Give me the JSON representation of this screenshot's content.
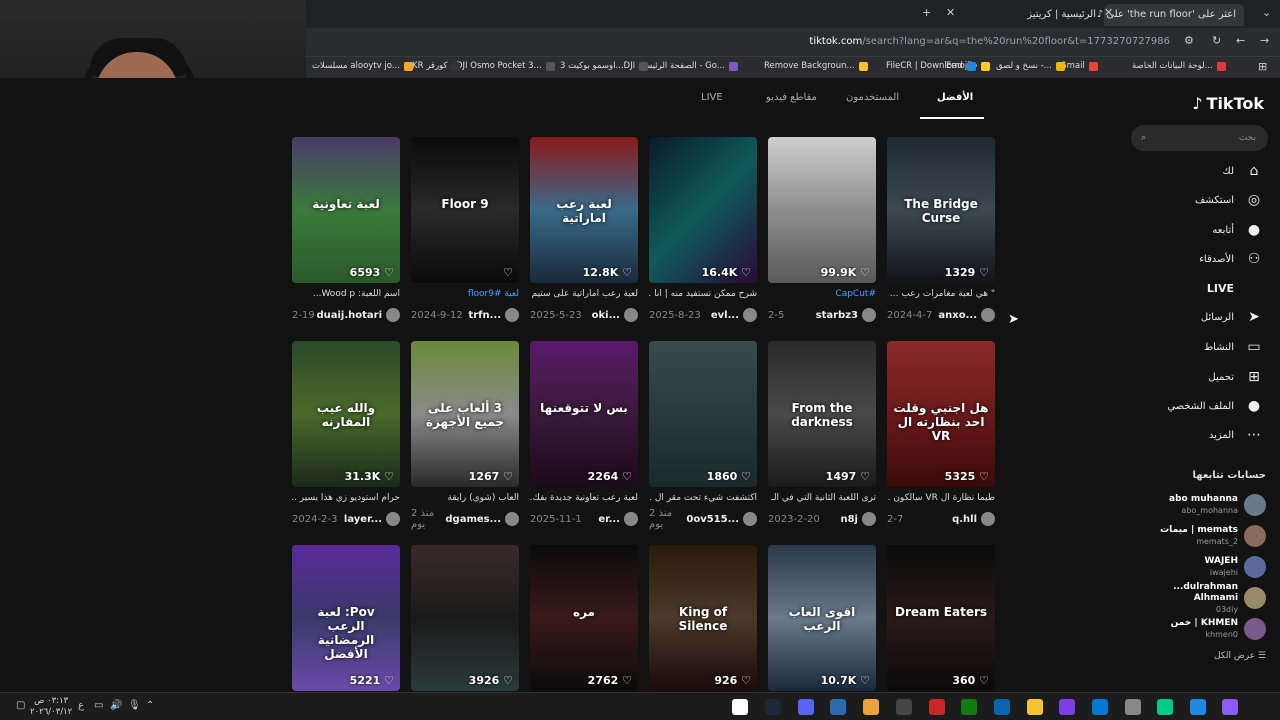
{
  "browser": {
    "tabs": [
      {
        "label": "اعثر على 'the run floor' على"
      },
      {
        "label": "الرئيسية | كريتيز"
      }
    ],
    "new_tab": "+",
    "url_host": "tiktok.com",
    "url_rest": "/search?lang=ar&q=the%20run%20floor&t=1773270727986",
    "bookmarks": [
      {
        "label": "لوحة البيانات الخاصة...",
        "color": "#e53935"
      },
      {
        "label": "Gmail",
        "color": "#ea4335"
      },
      {
        "label": "نسخ و لصق -...",
        "color": "#f4b400"
      },
      {
        "label": "Emojilo",
        "color": "#ffca28"
      },
      {
        "label": "FileCR | Download",
        "color": "#1e88e5"
      },
      {
        "label": "Remove Backgroun...",
        "color": "#fbc02d"
      },
      {
        "label": "الصفحة الرئيسية - Go...",
        "color": "#7e57c2"
      },
      {
        "label": "اوسمو بوكيت 3...DJI",
        "color": "#555"
      },
      {
        "label": "DJI Osmo Pocket 3...",
        "color": "#555"
      },
      {
        "label": "KR كورقر",
        "color": "#333"
      },
      {
        "label": "مسلسلات alooytv jo...",
        "color": "#f9a825"
      }
    ]
  },
  "tiktok": {
    "logo": "TikTok",
    "search_placeholder": "بحث",
    "nav": [
      {
        "label": "لك",
        "icon": "home-icon",
        "glyph": "⌂"
      },
      {
        "label": "استكشف",
        "icon": "compass-icon",
        "glyph": "◎"
      },
      {
        "label": "أتابعه",
        "icon": "avatar-icon",
        "glyph": "●"
      },
      {
        "label": "الأصدقاء",
        "icon": "friends-icon",
        "glyph": "⚇"
      },
      {
        "label": "LIVE",
        "icon": "live-icon",
        "glyph": ""
      },
      {
        "label": "الرسائل",
        "icon": "messages-icon",
        "glyph": "➤"
      },
      {
        "label": "النشاط",
        "icon": "activity-icon",
        "glyph": "▭"
      },
      {
        "label": "تحميل",
        "icon": "upload-icon",
        "glyph": "⊞"
      },
      {
        "label": "الملف الشخصي",
        "icon": "profile-icon",
        "glyph": "●"
      },
      {
        "label": "المزيد",
        "icon": "more-icon",
        "glyph": "⋯"
      }
    ],
    "following_title": "حسابات تتابعها",
    "following": [
      {
        "name": "abo muhanna",
        "handle": "abo_mohanna"
      },
      {
        "name": "ميمات | memats",
        "handle": "memats_2"
      },
      {
        "name": "WAJEH",
        "handle": "iwajehi"
      },
      {
        "name": "...dulrahman Alhmami",
        "handle": "03diy"
      },
      {
        "name": "خمن | KHMEN",
        "handle": "khmen0"
      }
    ],
    "see_all": "عرض الكل",
    "tabs": [
      {
        "label": "الأفضل"
      },
      {
        "label": "المستخدمون"
      },
      {
        "label": "مقاطع فيديو"
      },
      {
        "label": "LIVE"
      }
    ],
    "videos": [
      {
        "likes": "1329",
        "overlay": "The Bridge Curse",
        "desc": "\" هي لعبة مغامرات رعب ...",
        "date": "2024-4-7",
        "user": "anxo...",
        "bg": "linear-gradient(180deg,#1d2a33,#3c4a50,#101418)",
        "tag": false
      },
      {
        "likes": "99.9K",
        "overlay": "",
        "desc": "#CapCut",
        "date": "2-5",
        "user": "starbz3",
        "bg": "linear-gradient(180deg,#cfcfcf,#8e8e8e,#5a5a5a)",
        "tag": true
      },
      {
        "likes": "16.4K",
        "overlay": "",
        "desc": "شرح ممكن تستفيد منه | انا ...",
        "date": "2025-8-23",
        "user": "evl...",
        "bg": "linear-gradient(135deg,#0a1a2a,#0f5a5a,#2a0a3a)",
        "tag": false
      },
      {
        "likes": "12.8K",
        "overlay": "لعبة رعب اماراتية",
        "desc": "لعبة رعب اماراتية على ستيم ...",
        "date": "2025-5-23",
        "user": "oki...",
        "bg": "linear-gradient(180deg,#8a1a1a,#3a6a8a,#1a2a3a)",
        "tag": false
      },
      {
        "likes": "",
        "overlay": "Floor 9",
        "desc": "لعبة #floor9",
        "date": "2024-9-12",
        "user": "trfn...",
        "bg": "linear-gradient(180deg,#0a0a0a,#2a2a2a,#0a0a0a)",
        "tag": true
      },
      {
        "likes": "6593",
        "overlay": "لعبة تعاونية",
        "desc": "اسم اللعبة: Wood p...",
        "date": "2-19",
        "user": "duaij.hotari",
        "bg": "linear-gradient(180deg,#4a3a6a,#3a7a3a,#2a5a2a)",
        "tag": false
      },
      {
        "likes": "5325",
        "overlay": "هل اجنبي وقلت احد بنظارته ال VR",
        "desc": "طيما نظارة ال VR سالكون ...",
        "date": "2-7",
        "user": "q.hll",
        "bg": "linear-gradient(180deg,#8a2a2a,#6a1a1a,#3a0a0a)",
        "tag": false
      },
      {
        "likes": "1497",
        "overlay": "From the darkness",
        "desc": "ترى اللعبة الثانية التي في الـ ...",
        "date": "2023-2-20",
        "user": "n8j",
        "bg": "linear-gradient(180deg,#2a2a2a,#4a4a4a,#1a1a1a)",
        "tag": false
      },
      {
        "likes": "1860",
        "overlay": "",
        "desc": "اكتشفت شيء تحت مقر ال ...",
        "date": "منذ 2 يوم",
        "user": "0ov515...",
        "bg": "linear-gradient(180deg,#3a4a4a,#2a3a3a,#1a2a2a)",
        "tag": false
      },
      {
        "likes": "2264",
        "overlay": "بس لا تتوقعنها",
        "desc": "لعبة رعب تعاونية جديدة بفك...",
        "date": "2025-11-1",
        "user": "er...",
        "bg": "linear-gradient(180deg,#5a1a6a,#3a1a3a,#1a0a1a)",
        "tag": false
      },
      {
        "likes": "1267",
        "overlay": "3 ألعاب على جميع الأجهزة",
        "desc": "ألعاب (شوي) رايقة",
        "date": "منذ 2 يوم",
        "user": "dgames...",
        "bg": "linear-gradient(180deg,#6a8a3a,#8a8a8a,#2a2a2a)",
        "tag": false
      },
      {
        "likes": "31.3K",
        "overlay": "والله عيب المقارنه",
        "desc": "حرام استوديو زي هذا يسير ...",
        "date": "2024-2-3",
        "user": "layer...",
        "bg": "linear-gradient(180deg,#2a4a2a,#4a6a2a,#1a2a1a)",
        "tag": false
      },
      {
        "likes": "360",
        "overlay": "Dream Eaters",
        "desc": "",
        "date": "",
        "user": "",
        "bg": "linear-gradient(180deg,#0a0a0a,#2a1a1a,#0a0a0a)",
        "tag": false
      },
      {
        "likes": "10.7K",
        "overlay": "اقوى العاب الرعب",
        "desc": "",
        "date": "",
        "user": "",
        "bg": "linear-gradient(180deg,#2a3a4a,#6a7a8a,#1a2a3a)",
        "tag": false
      },
      {
        "likes": "926",
        "overlay": "King of Silence",
        "desc": "",
        "date": "",
        "user": "",
        "bg": "linear-gradient(180deg,#2a1a0a,#4a3a2a,#1a0a0a)",
        "tag": false
      },
      {
        "likes": "2762",
        "overlay": "مره",
        "desc": "",
        "date": "",
        "user": "",
        "bg": "linear-gradient(180deg,#0a0a0a,#3a1a1a,#0a0a0a)",
        "tag": false
      },
      {
        "likes": "3926",
        "overlay": "",
        "desc": "",
        "date": "",
        "user": "",
        "bg": "linear-gradient(180deg,#3a2a2a,#1a1a1a,#2a3a3a)",
        "tag": false
      },
      {
        "likes": "5221",
        "overlay": "Pov: لعبة الرعب الرمضانية الأفضل",
        "desc": "",
        "date": "",
        "user": "",
        "bg": "linear-gradient(180deg,#5a2a9a,#3a3a6a,#6a4aaa)",
        "tag": false
      }
    ]
  },
  "taskbar": {
    "time": "٠٣:١٣ ص",
    "date": "٢٠٢٦/٠٣/١٢"
  }
}
